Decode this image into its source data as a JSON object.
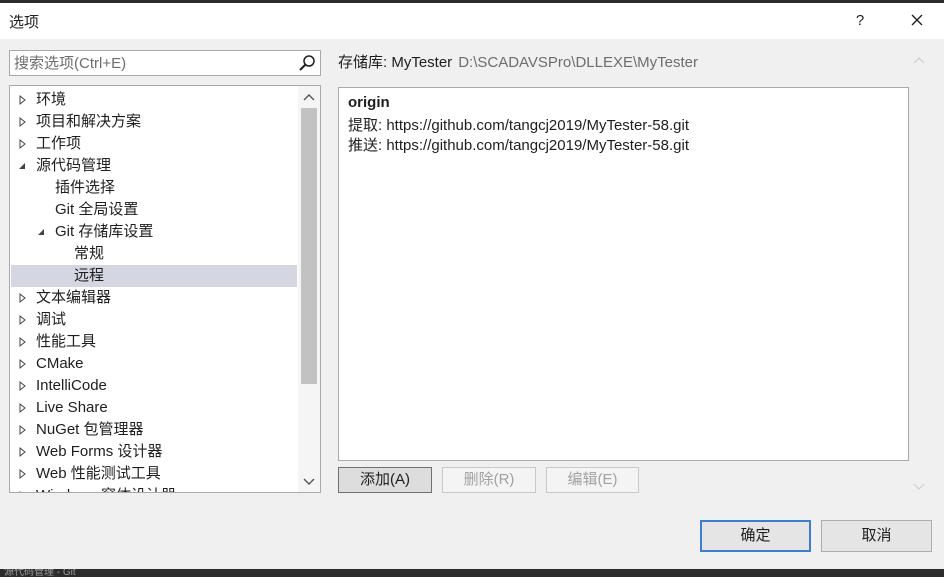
{
  "dialog": {
    "title": "选项",
    "help_label": "?",
    "close_icon": "close-icon"
  },
  "search": {
    "placeholder": "搜索选项(Ctrl+E)",
    "icon": "search-icon"
  },
  "tree": {
    "items": [
      {
        "label": "环境",
        "expander": "collapsed"
      },
      {
        "label": "项目和解决方案",
        "expander": "collapsed"
      },
      {
        "label": "工作项",
        "expander": "collapsed"
      },
      {
        "label": "源代码管理",
        "expander": "expanded"
      },
      {
        "label": "插件选择",
        "expander": "none"
      },
      {
        "label": "Git 全局设置",
        "expander": "none"
      },
      {
        "label": "Git 存储库设置",
        "expander": "expanded"
      },
      {
        "label": "常规",
        "expander": "none"
      },
      {
        "label": "远程",
        "expander": "none",
        "selected": true
      },
      {
        "label": "文本编辑器",
        "expander": "collapsed"
      },
      {
        "label": "调试",
        "expander": "collapsed"
      },
      {
        "label": "性能工具",
        "expander": "collapsed"
      },
      {
        "label": "CMake",
        "expander": "collapsed"
      },
      {
        "label": "IntelliCode",
        "expander": "collapsed"
      },
      {
        "label": "Live Share",
        "expander": "collapsed"
      },
      {
        "label": "NuGet 包管理器",
        "expander": "collapsed"
      },
      {
        "label": "Web Forms 设计器",
        "expander": "collapsed"
      },
      {
        "label": "Web 性能测试工具",
        "expander": "collapsed"
      },
      {
        "label": "Windows 窗体设计器",
        "expander": "collapsed"
      }
    ]
  },
  "repo": {
    "label": "存储库: MyTester",
    "path": "D:\\SCADAVSPro\\DLLEXE\\MyTester"
  },
  "remotes": {
    "name": "origin",
    "fetch": "提取: https://github.com/tangcj2019/MyTester-58.git",
    "push": "推送: https://github.com/tangcj2019/MyTester-58.git"
  },
  "buttons": {
    "add": "添加(A)",
    "delete": "删除(R)",
    "edit": "编辑(E)",
    "ok": "确定",
    "cancel": "取消"
  },
  "background": {
    "bottom_text": "源代码管理 - Git"
  }
}
